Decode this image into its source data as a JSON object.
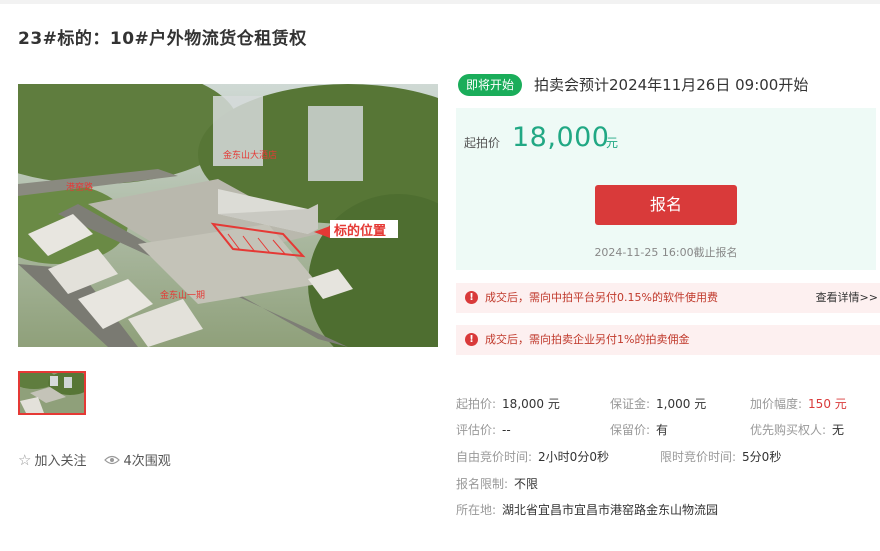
{
  "title": "23#标的：10#户外物流货仓租赁权",
  "gallery": {
    "labels": [
      "金东山大酒店",
      "港窑路",
      "标的位置",
      "金东山一期"
    ]
  },
  "actions": {
    "follow": "加入关注",
    "views": "4次围观"
  },
  "status": {
    "badge": "即将开始",
    "start_text": "拍卖会预计2024年11月26日  09:00开始"
  },
  "price": {
    "label": "起拍价",
    "value": "18,000",
    "unit": "元",
    "signup_label": "报名",
    "deadline": "2024-11-25 16:00截止报名"
  },
  "notices": [
    {
      "text": "成交后，需向中拍平台另付0.15%的软件使用费",
      "link": "查看详情>>"
    },
    {
      "text": "成交后，需向拍卖企业另付1%的拍卖佣金"
    }
  ],
  "details": {
    "start_price": {
      "label": "起拍价:",
      "value": "18,000 元"
    },
    "deposit": {
      "label": "保证金:",
      "value": "1,000 元"
    },
    "increment": {
      "label": "加价幅度:",
      "value": "150 元"
    },
    "appraisal": {
      "label": "评估价:",
      "value": "--"
    },
    "reserve": {
      "label": "保留价:",
      "value": "有"
    },
    "priority": {
      "label": "优先购买权人:",
      "value": "无"
    },
    "free_time": {
      "label": "自由竞价时间:",
      "value": "2小时0分0秒"
    },
    "limited_time": {
      "label": "限时竞价时间:",
      "value": "5分0秒"
    },
    "restriction": {
      "label": "报名限制:",
      "value": "不限"
    },
    "location": {
      "label": "所在地:",
      "value": "湖北省宜昌市宜昌市港窑路金东山物流园"
    }
  },
  "colors": {
    "accent_green": "#21a884",
    "badge_green": "#1aad5a",
    "primary_red": "#d93a3a"
  }
}
